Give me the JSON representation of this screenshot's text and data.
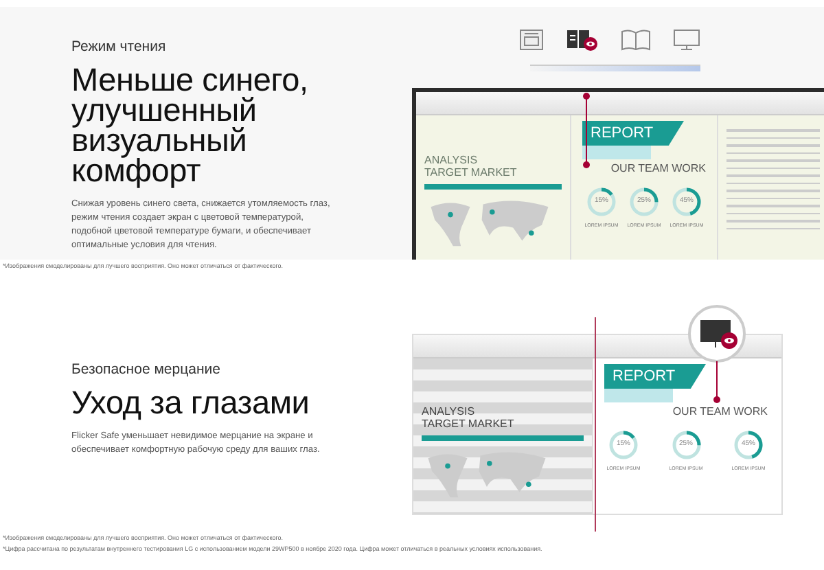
{
  "sections": [
    {
      "kind": "reading",
      "eyebrow": "Режим чтения",
      "title_lines": [
        "Меньше синего,",
        "улучшенный",
        "визуальный комфорт"
      ],
      "body": "Снижая уровень синего света, снижается утомляемость глаз, режим чтения создает экран с цветовой температурой, подобной цветовой температуре бумаги, и обеспечивает оптимальные условия для чтения.",
      "modes": [
        {
          "kind": "newspaper",
          "selected": false
        },
        {
          "kind": "book",
          "selected": true
        },
        {
          "kind": "open-book",
          "selected": false
        },
        {
          "kind": "monitor",
          "selected": false
        }
      ],
      "doc": {
        "analysis": [
          "ANALYSIS",
          "TARGET MARKET"
        ],
        "report": "REPORT",
        "team": "OUR TEAM WORK",
        "rings": [
          {
            "value": "15%",
            "level": 0.15,
            "caption": "LOREM IPSUM"
          },
          {
            "value": "25%",
            "level": 0.25,
            "caption": "LOREM IPSUM"
          },
          {
            "value": "45%",
            "level": 0.45,
            "caption": "LOREM IPSUM"
          }
        ]
      },
      "footnotes": [
        "*Изображения смоделированы для лучшего восприятия. Оно может отличаться от фактического."
      ]
    },
    {
      "kind": "flicker",
      "eyebrow": "Безопасное мерцание",
      "title_lines": [
        "Уход за глазами"
      ],
      "body": "Flicker Safe уменьшает невидимое мерцание на экране и обеспечивает комфортную рабочую среду для ваших глаз.",
      "doc": {
        "analysis": [
          "ANALYSIS",
          "TARGET MARKET"
        ],
        "report": "REPORT",
        "team": "OUR TEAM WORK",
        "rings": [
          {
            "value": "15%",
            "level": 0.15,
            "caption": "LOREM IPSUM"
          },
          {
            "value": "25%",
            "level": 0.25,
            "caption": "LOREM IPSUM"
          },
          {
            "value": "45%",
            "level": 0.45,
            "caption": "LOREM IPSUM"
          }
        ]
      },
      "footnotes": [
        "*Изображения смоделированы для лучшего восприятия. Оно может отличаться от фактического.",
        "*Цифра рассчитана по результатам внутреннего тестирования LG с использованием модели 29WP500 в ноябре 2020 года. Цифра может отличаться в реальных условиях использования."
      ]
    }
  ]
}
